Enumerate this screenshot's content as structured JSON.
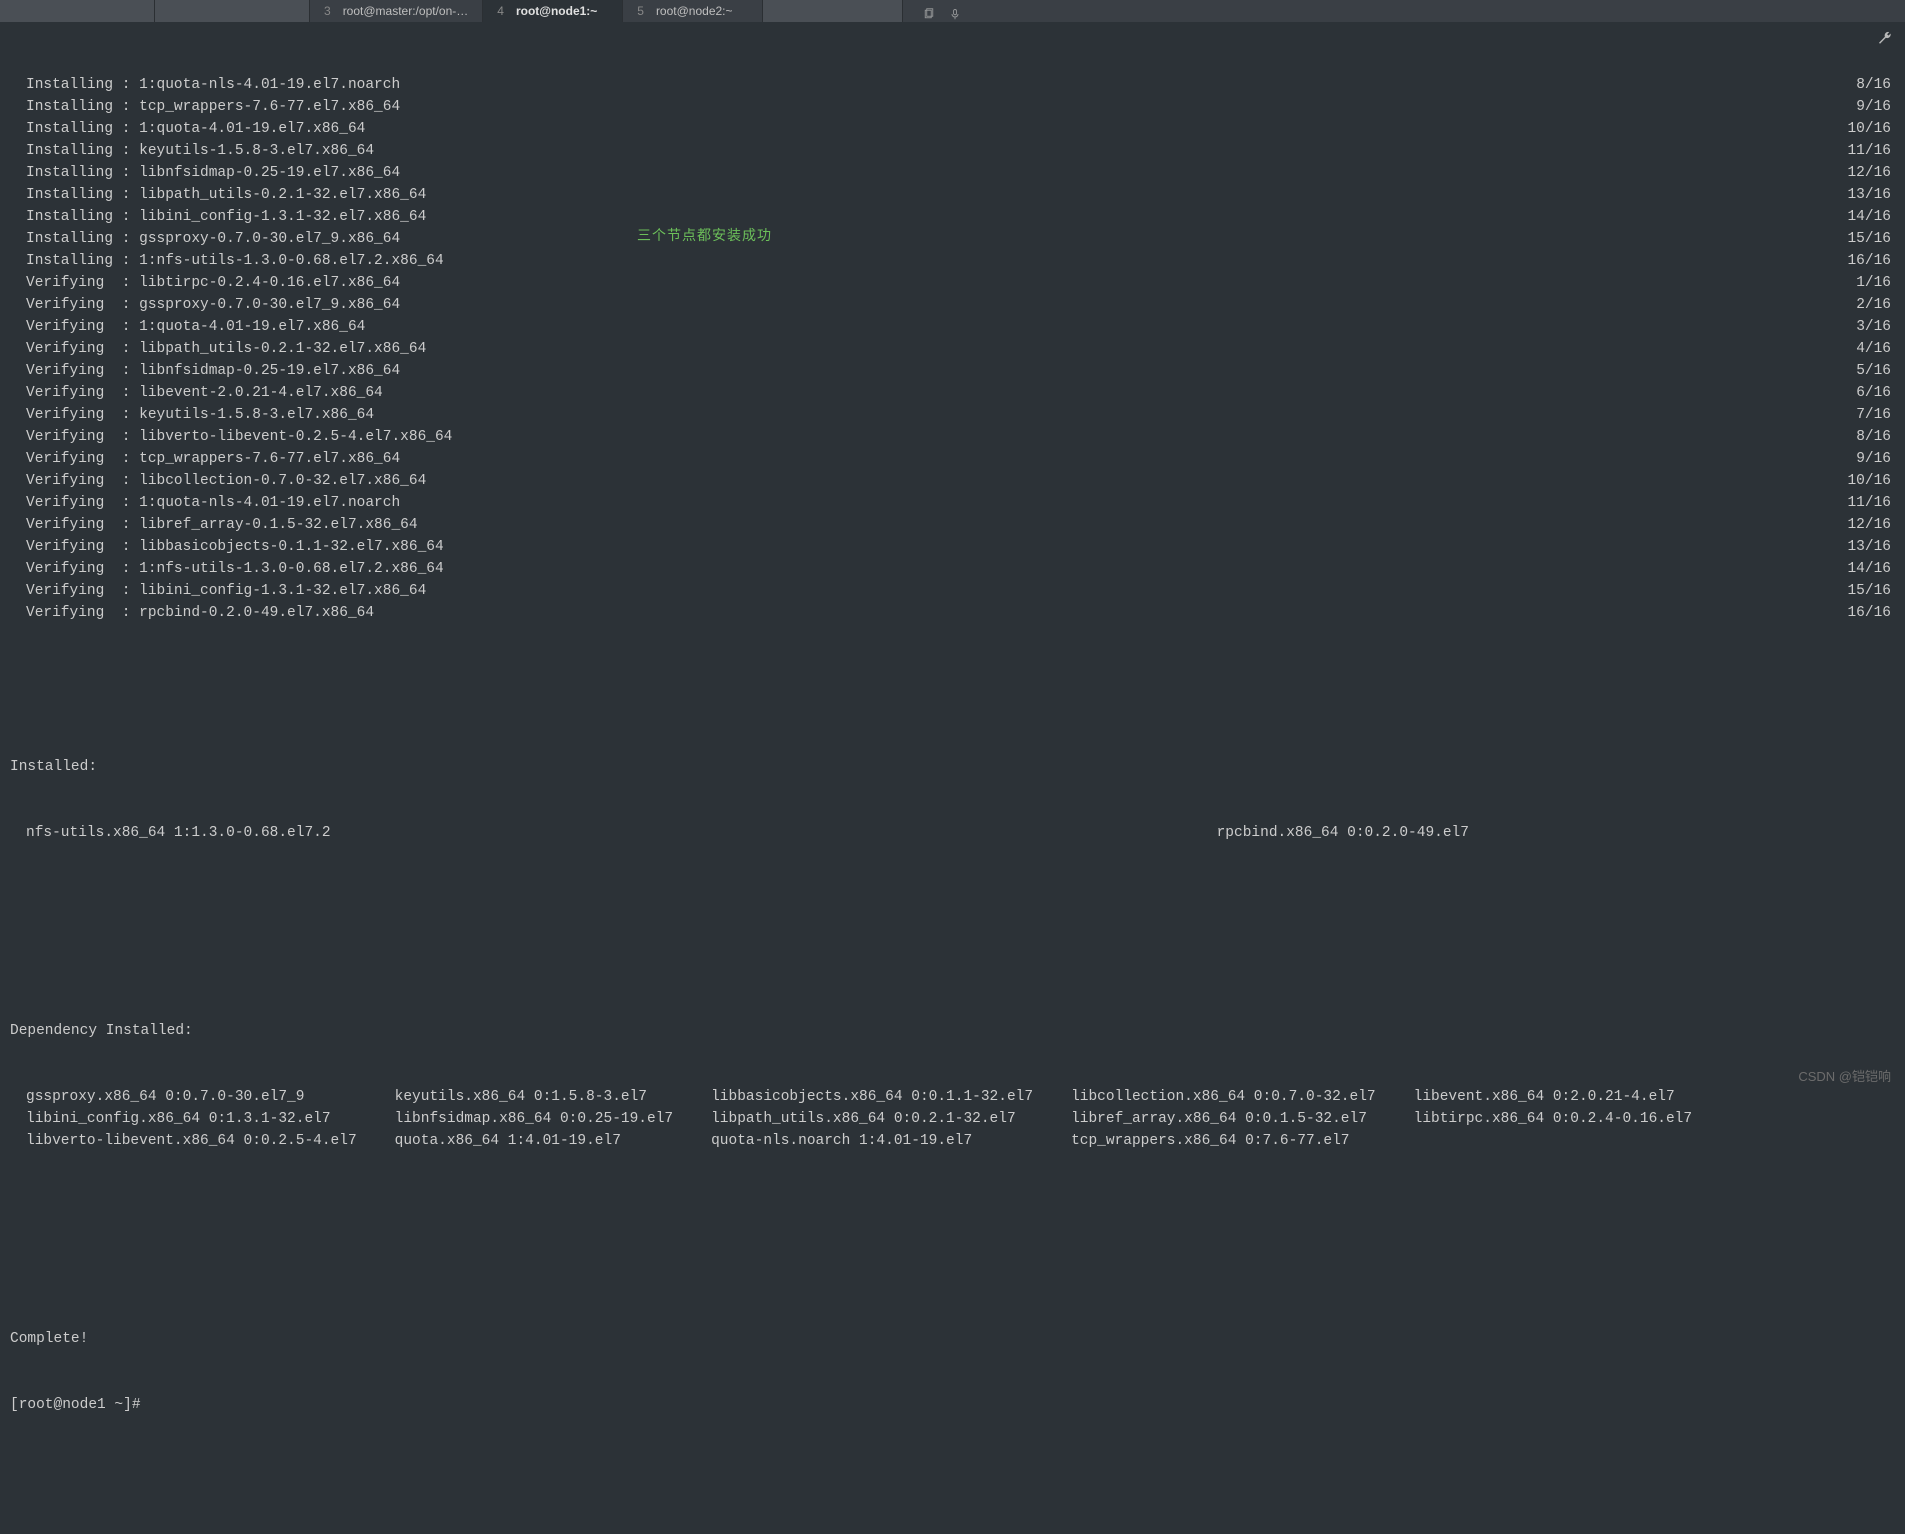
{
  "tabs": [
    {
      "num": "",
      "title": ""
    },
    {
      "num": "",
      "title": ""
    },
    {
      "num": "3",
      "title": "root@master:/opt/on-…"
    },
    {
      "num": "4",
      "title": "root@node1:~"
    },
    {
      "num": "5",
      "title": "root@node2:~"
    },
    {
      "num": "",
      "title": ""
    }
  ],
  "lines": [
    {
      "text": "Installing : 1:quota-nls-4.01-19.el7.noarch",
      "prog": "8/16"
    },
    {
      "text": "Installing : tcp_wrappers-7.6-77.el7.x86_64",
      "prog": "9/16"
    },
    {
      "text": "Installing : 1:quota-4.01-19.el7.x86_64",
      "prog": "10/16"
    },
    {
      "text": "Installing : keyutils-1.5.8-3.el7.x86_64",
      "prog": "11/16"
    },
    {
      "text": "Installing : libnfsidmap-0.25-19.el7.x86_64",
      "prog": "12/16"
    },
    {
      "text": "Installing : libpath_utils-0.2.1-32.el7.x86_64",
      "prog": "13/16"
    },
    {
      "text": "Installing : libini_config-1.3.1-32.el7.x86_64",
      "prog": "14/16"
    },
    {
      "text": "Installing : gssproxy-0.7.0-30.el7_9.x86_64",
      "prog": "15/16"
    },
    {
      "text": "Installing : 1:nfs-utils-1.3.0-0.68.el7.2.x86_64",
      "prog": "16/16"
    },
    {
      "text": "Verifying  : libtirpc-0.2.4-0.16.el7.x86_64",
      "prog": "1/16"
    },
    {
      "text": "Verifying  : gssproxy-0.7.0-30.el7_9.x86_64",
      "prog": "2/16"
    },
    {
      "text": "Verifying  : 1:quota-4.01-19.el7.x86_64",
      "prog": "3/16"
    },
    {
      "text": "Verifying  : libpath_utils-0.2.1-32.el7.x86_64",
      "prog": "4/16"
    },
    {
      "text": "Verifying  : libnfsidmap-0.25-19.el7.x86_64",
      "prog": "5/16"
    },
    {
      "text": "Verifying  : libevent-2.0.21-4.el7.x86_64",
      "prog": "6/16"
    },
    {
      "text": "Verifying  : keyutils-1.5.8-3.el7.x86_64",
      "prog": "7/16"
    },
    {
      "text": "Verifying  : libverto-libevent-0.2.5-4.el7.x86_64",
      "prog": "8/16"
    },
    {
      "text": "Verifying  : tcp_wrappers-7.6-77.el7.x86_64",
      "prog": "9/16"
    },
    {
      "text": "Verifying  : libcollection-0.7.0-32.el7.x86_64",
      "prog": "10/16"
    },
    {
      "text": "Verifying  : 1:quota-nls-4.01-19.el7.noarch",
      "prog": "11/16"
    },
    {
      "text": "Verifying  : libref_array-0.1.5-32.el7.x86_64",
      "prog": "12/16"
    },
    {
      "text": "Verifying  : libbasicobjects-0.1.1-32.el7.x86_64",
      "prog": "13/16"
    },
    {
      "text": "Verifying  : 1:nfs-utils-1.3.0-0.68.el7.2.x86_64",
      "prog": "14/16"
    },
    {
      "text": "Verifying  : libini_config-1.3.1-32.el7.x86_64",
      "prog": "15/16"
    },
    {
      "text": "Verifying  : rpcbind-0.2.0-49.el7.x86_64",
      "prog": "16/16"
    }
  ],
  "installed_header": "Installed:",
  "installed": [
    "nfs-utils.x86_64 1:1.3.0-0.68.el7.2",
    "rpcbind.x86_64 0:0.2.0-49.el7"
  ],
  "dep_header": "Dependency Installed:",
  "deps": [
    "gssproxy.x86_64 0:0.7.0-30.el7_9",
    "keyutils.x86_64 0:1.5.8-3.el7",
    "libbasicobjects.x86_64 0:0.1.1-32.el7",
    "libcollection.x86_64 0:0.7.0-32.el7",
    "libevent.x86_64 0:2.0.21-4.el7",
    "libini_config.x86_64 0:1.3.1-32.el7",
    "libnfsidmap.x86_64 0:0.25-19.el7",
    "libpath_utils.x86_64 0:0.2.1-32.el7",
    "libref_array.x86_64 0:0.1.5-32.el7",
    "libtirpc.x86_64 0:0.2.4-0.16.el7",
    "libverto-libevent.x86_64 0:0.2.5-4.el7",
    "quota.x86_64 1:4.01-19.el7",
    "quota-nls.noarch 1:4.01-19.el7",
    "tcp_wrappers.x86_64 0:7.6-77.el7",
    ""
  ],
  "complete": "Complete!",
  "prompt": "[root@node1 ~]# ",
  "overlay": "三个节点都安装成功",
  "watermark": "CSDN @铠铠响"
}
